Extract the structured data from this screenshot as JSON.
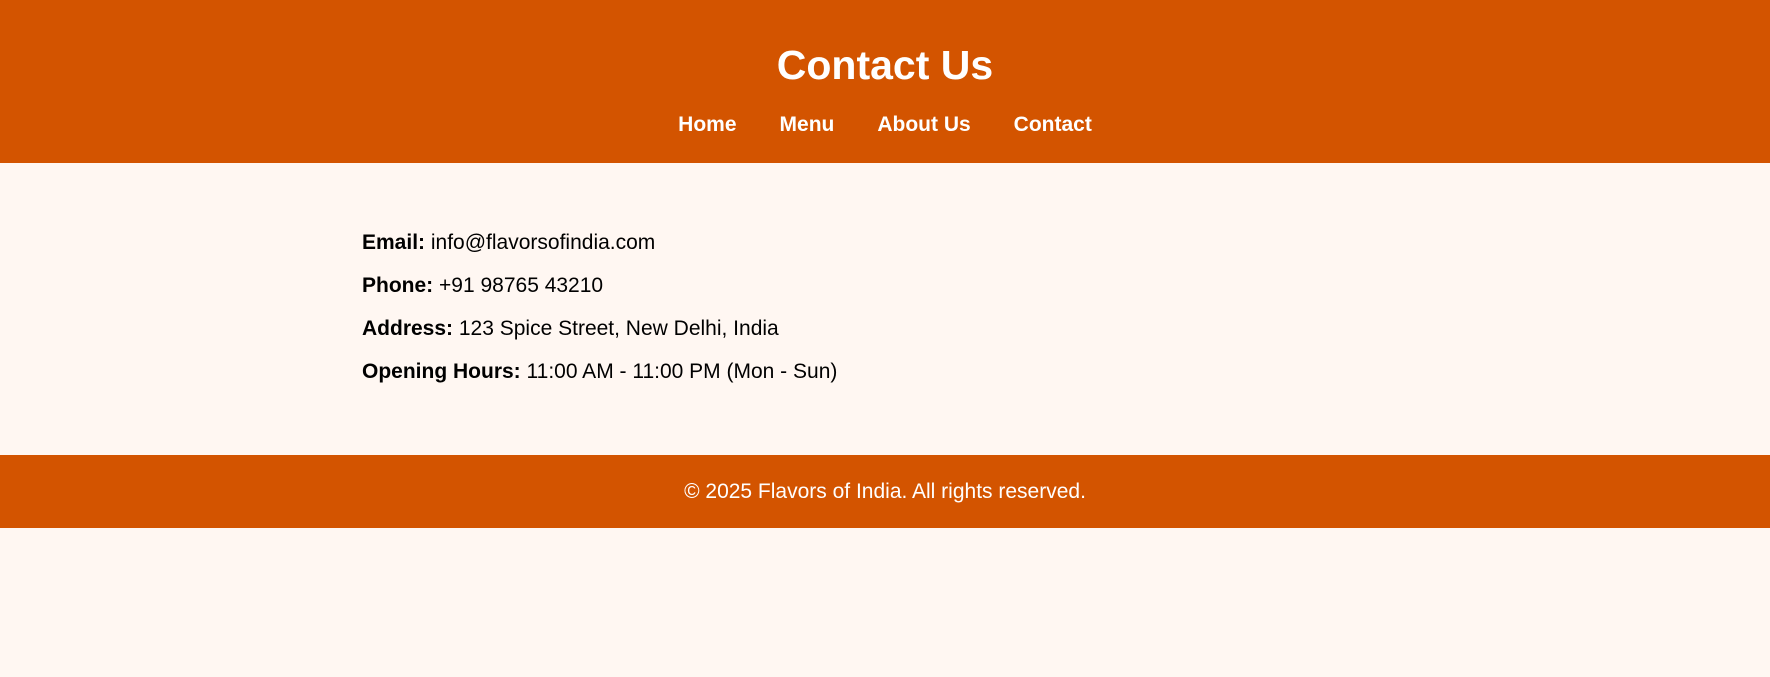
{
  "colors": {
    "brand": "#d35400",
    "background": "#fff7f2",
    "text": "#000000",
    "header_text": "#ffffff"
  },
  "header": {
    "title": "Contact Us",
    "nav": [
      {
        "label": "Home"
      },
      {
        "label": "Menu"
      },
      {
        "label": "About Us"
      },
      {
        "label": "Contact"
      }
    ]
  },
  "contact": {
    "email": {
      "label": "Email:",
      "value": "info@flavorsofindia.com"
    },
    "phone": {
      "label": "Phone:",
      "value": "+91 98765 43210"
    },
    "address": {
      "label": "Address:",
      "value": "123 Spice Street, New Delhi, India"
    },
    "hours": {
      "label": "Opening Hours:",
      "value": "11:00 AM - 11:00 PM (Mon - Sun)"
    }
  },
  "footer": {
    "text": "© 2025 Flavors of India. All rights reserved."
  }
}
